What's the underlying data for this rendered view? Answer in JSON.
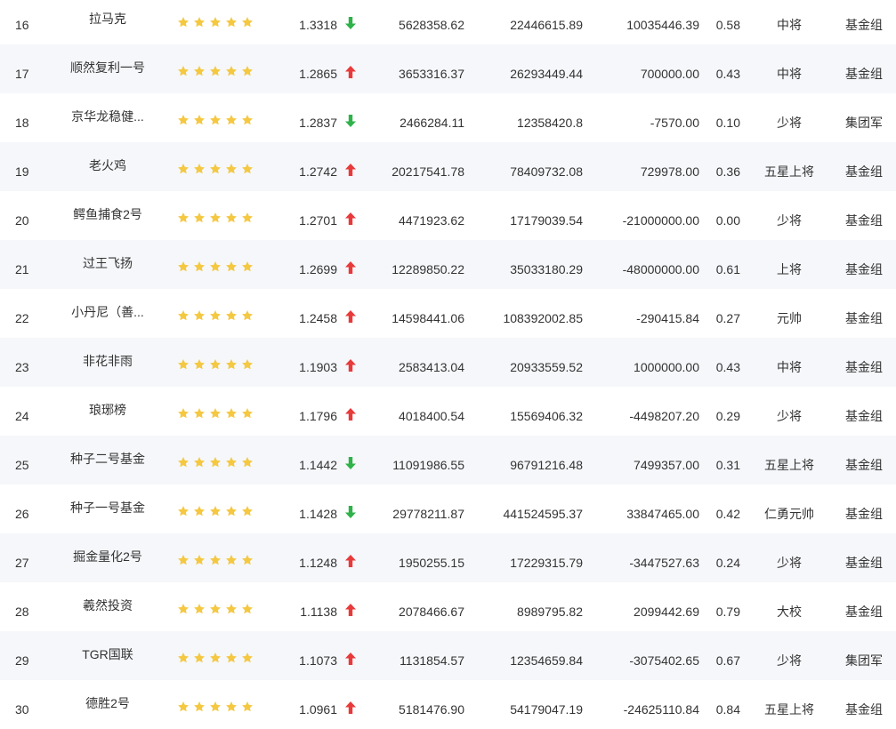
{
  "colors": {
    "star": "#f5c842",
    "up": "#e83a3a",
    "down": "#2fb24a",
    "row_alt": "#f5f7fa",
    "text": "#333333"
  },
  "rows": [
    {
      "rank": "16",
      "name": "拉马克",
      "stars": 5,
      "nav": "1.3318",
      "trend": "down",
      "v1": "5628358.62",
      "v2": "22446615.89",
      "v3": "10035446.39",
      "ratio": "0.58",
      "title": "中将",
      "group": "基金组"
    },
    {
      "rank": "17",
      "name": "顺然复利一号",
      "stars": 5,
      "nav": "1.2865",
      "trend": "up",
      "v1": "3653316.37",
      "v2": "26293449.44",
      "v3": "700000.00",
      "ratio": "0.43",
      "title": "中将",
      "group": "基金组"
    },
    {
      "rank": "18",
      "name": "京华龙稳健...",
      "stars": 5,
      "nav": "1.2837",
      "trend": "down",
      "v1": "2466284.11",
      "v2": "12358420.8",
      "v3": "-7570.00",
      "ratio": "0.10",
      "title": "少将",
      "group": "集团军"
    },
    {
      "rank": "19",
      "name": "老火鸡",
      "stars": 5,
      "nav": "1.2742",
      "trend": "up",
      "v1": "20217541.78",
      "v2": "78409732.08",
      "v3": "729978.00",
      "ratio": "0.36",
      "title": "五星上将",
      "group": "基金组"
    },
    {
      "rank": "20",
      "name": "鳄鱼捕食2号",
      "stars": 5,
      "nav": "1.2701",
      "trend": "up",
      "v1": "4471923.62",
      "v2": "17179039.54",
      "v3": "-21000000.00",
      "ratio": "0.00",
      "title": "少将",
      "group": "基金组"
    },
    {
      "rank": "21",
      "name": "过王飞扬",
      "stars": 5,
      "nav": "1.2699",
      "trend": "up",
      "v1": "12289850.22",
      "v2": "35033180.29",
      "v3": "-48000000.00",
      "ratio": "0.61",
      "title": "上将",
      "group": "基金组"
    },
    {
      "rank": "22",
      "name": "小丹尼（善...",
      "stars": 5,
      "nav": "1.2458",
      "trend": "up",
      "v1": "14598441.06",
      "v2": "108392002.85",
      "v3": "-290415.84",
      "ratio": "0.27",
      "title": "元帅",
      "group": "基金组"
    },
    {
      "rank": "23",
      "name": "非花非雨",
      "stars": 5,
      "nav": "1.1903",
      "trend": "up",
      "v1": "2583413.04",
      "v2": "20933559.52",
      "v3": "1000000.00",
      "ratio": "0.43",
      "title": "中将",
      "group": "基金组"
    },
    {
      "rank": "24",
      "name": "琅琊榜",
      "stars": 5,
      "nav": "1.1796",
      "trend": "up",
      "v1": "4018400.54",
      "v2": "15569406.32",
      "v3": "-4498207.20",
      "ratio": "0.29",
      "title": "少将",
      "group": "基金组"
    },
    {
      "rank": "25",
      "name": "种子二号基金",
      "stars": 5,
      "nav": "1.1442",
      "trend": "down",
      "v1": "11091986.55",
      "v2": "96791216.48",
      "v3": "7499357.00",
      "ratio": "0.31",
      "title": "五星上将",
      "group": "基金组"
    },
    {
      "rank": "26",
      "name": "种子一号基金",
      "stars": 5,
      "nav": "1.1428",
      "trend": "down",
      "v1": "29778211.87",
      "v2": "441524595.37",
      "v3": "33847465.00",
      "ratio": "0.42",
      "title": "仁勇元帅",
      "group": "基金组"
    },
    {
      "rank": "27",
      "name": "掘金量化2号",
      "stars": 5,
      "nav": "1.1248",
      "trend": "up",
      "v1": "1950255.15",
      "v2": "17229315.79",
      "v3": "-3447527.63",
      "ratio": "0.24",
      "title": "少将",
      "group": "基金组"
    },
    {
      "rank": "28",
      "name": "羲然投资",
      "stars": 5,
      "nav": "1.1138",
      "trend": "up",
      "v1": "2078466.67",
      "v2": "8989795.82",
      "v3": "2099442.69",
      "ratio": "0.79",
      "title": "大校",
      "group": "基金组"
    },
    {
      "rank": "29",
      "name": "TGR国联",
      "stars": 5,
      "nav": "1.1073",
      "trend": "up",
      "v1": "1131854.57",
      "v2": "12354659.84",
      "v3": "-3075402.65",
      "ratio": "0.67",
      "title": "少将",
      "group": "集团军"
    },
    {
      "rank": "30",
      "name": "德胜2号",
      "stars": 5,
      "nav": "1.0961",
      "trend": "up",
      "v1": "5181476.90",
      "v2": "54179047.19",
      "v3": "-24625110.84",
      "ratio": "0.84",
      "title": "五星上将",
      "group": "基金组"
    }
  ]
}
